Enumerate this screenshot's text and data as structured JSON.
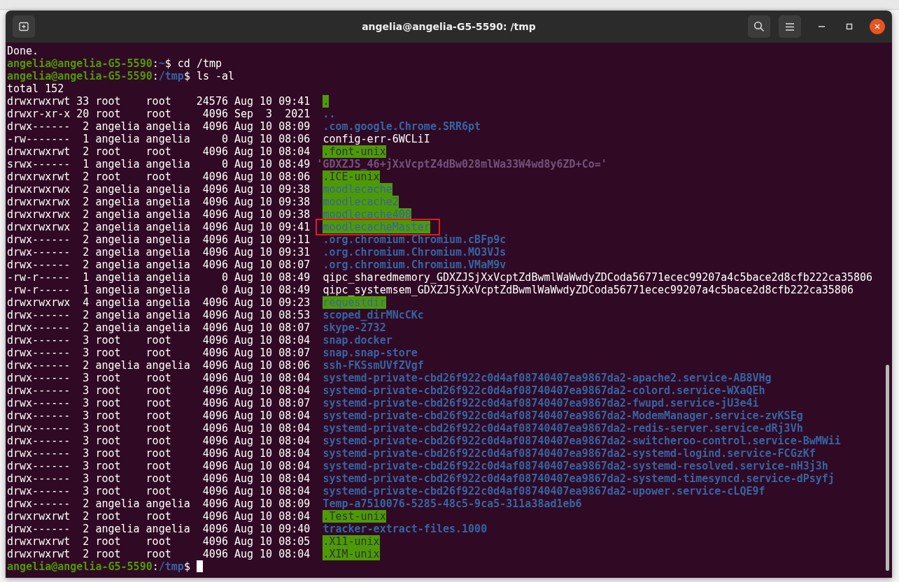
{
  "window": {
    "title": "angelia@angelia-G5-5590: /tmp"
  },
  "terminal": {
    "lines": [
      {
        "kind": "text",
        "text": "Done."
      },
      {
        "kind": "prompt",
        "user_host": "angelia@angelia-G5-5590",
        "colon": ":",
        "path": "~",
        "symbol": "$",
        "command": "cd /tmp"
      },
      {
        "kind": "prompt",
        "user_host": "angelia@angelia-G5-5590",
        "colon": ":",
        "path": "/tmp",
        "symbol": "$",
        "command": "ls -al"
      },
      {
        "kind": "text",
        "text": "total 152"
      },
      {
        "kind": "entry",
        "perms": "drwxrwxrwt",
        "links": "33",
        "owner": "root",
        "group": "root",
        "size": "24576",
        "date": "Aug 10 09:41",
        "name": ".",
        "bold": false,
        "world_writable": true,
        "sticky": true,
        "highlighted": false
      },
      {
        "kind": "entry",
        "perms": "drwxr-xr-x",
        "links": "20",
        "owner": "root",
        "group": "root",
        "size": "4096",
        "date": "Sep  3  2021",
        "name": "..",
        "color": "#3465a4",
        "bold": true,
        "world_writable": false,
        "highlighted": false
      },
      {
        "kind": "entry",
        "perms": "drwx------",
        "links": "2",
        "owner": "angelia",
        "group": "angelia",
        "size": "4096",
        "date": "Aug 10 08:09",
        "name": ".com.google.Chrome.SRR6pt",
        "color": "#3465a4",
        "bold": true,
        "world_writable": false,
        "highlighted": false
      },
      {
        "kind": "entry",
        "perms": "-rw-------",
        "links": "1",
        "owner": "angelia",
        "group": "angelia",
        "size": "0",
        "date": "Aug 10 08:06",
        "name": "config-err-6WCLiI",
        "color": "#ffffff",
        "bold": false,
        "world_writable": false,
        "highlighted": false
      },
      {
        "kind": "entry",
        "perms": "drwxrwxrwt",
        "links": "2",
        "owner": "root",
        "group": "root",
        "size": "4096",
        "date": "Aug 10 08:04",
        "name": ".font-unix",
        "bold": false,
        "world_writable": true,
        "sticky": true,
        "highlighted": false
      },
      {
        "kind": "entry",
        "perms": "srwx------",
        "links": "1",
        "owner": "angelia",
        "group": "angelia",
        "size": "0",
        "date": "Aug 10 08:49",
        "name": "'GDXZJS_46+jXxVcptZ4dBw028mlWa33W4wd8y6ZD+Co='",
        "color": "#75507b",
        "bold": true,
        "world_writable": false,
        "quoted": true,
        "highlighted": false
      },
      {
        "kind": "entry",
        "perms": "drwxrwxrwt",
        "links": "2",
        "owner": "root",
        "group": "root",
        "size": "4096",
        "date": "Aug 10 08:06",
        "name": ".ICE-unix",
        "bold": false,
        "world_writable": true,
        "sticky": true,
        "highlighted": false
      },
      {
        "kind": "entry",
        "perms": "drwxrwxrwx",
        "links": "2",
        "owner": "angelia",
        "group": "angelia",
        "size": "4096",
        "date": "Aug 10 09:38",
        "name": "moodlecache",
        "bold": false,
        "world_writable": true,
        "sticky": false,
        "highlighted": false
      },
      {
        "kind": "entry",
        "perms": "drwxrwxrwx",
        "links": "2",
        "owner": "angelia",
        "group": "angelia",
        "size": "4096",
        "date": "Aug 10 09:38",
        "name": "moodlecache2",
        "bold": false,
        "world_writable": true,
        "sticky": false,
        "highlighted": false
      },
      {
        "kind": "entry",
        "perms": "drwxrwxrwx",
        "links": "2",
        "owner": "angelia",
        "group": "angelia",
        "size": "4096",
        "date": "Aug 10 09:38",
        "name": "moodlecache400",
        "bold": false,
        "world_writable": true,
        "sticky": false,
        "highlighted": false
      },
      {
        "kind": "entry",
        "perms": "drwxrwxrwx",
        "links": "2",
        "owner": "angelia",
        "group": "angelia",
        "size": "4096",
        "date": "Aug 10 09:41",
        "name": "moodlecacheMaster",
        "bold": false,
        "world_writable": true,
        "sticky": false,
        "highlighted": true
      },
      {
        "kind": "entry",
        "perms": "drwx------",
        "links": "2",
        "owner": "angelia",
        "group": "angelia",
        "size": "4096",
        "date": "Aug 10 09:11",
        "name": ".org.chromium.Chromium.cBFp9c",
        "color": "#3465a4",
        "bold": true,
        "world_writable": false,
        "highlighted": false
      },
      {
        "kind": "entry",
        "perms": "drwx------",
        "links": "2",
        "owner": "angelia",
        "group": "angelia",
        "size": "4096",
        "date": "Aug 10 09:31",
        "name": ".org.chromium.Chromium.MO3VJs",
        "color": "#3465a4",
        "bold": true,
        "world_writable": false,
        "highlighted": false
      },
      {
        "kind": "entry",
        "perms": "drwx------",
        "links": "2",
        "owner": "angelia",
        "group": "angelia",
        "size": "4096",
        "date": "Aug 10 08:07",
        "name": ".org.chromium.Chromium.VMaM9v",
        "color": "#3465a4",
        "bold": true,
        "world_writable": false,
        "highlighted": false
      },
      {
        "kind": "entry",
        "perms": "-rw-r-----",
        "links": "1",
        "owner": "angelia",
        "group": "angelia",
        "size": "0",
        "date": "Aug 10 08:49",
        "name": "qipc_sharedmemory_GDXZJSjXxVcptZdBwmlWaWwdyZDCoda56771ecec99207a4c5bace2d8cfb222ca35806",
        "color": "#ffffff",
        "bold": false,
        "world_writable": false,
        "highlighted": false
      },
      {
        "kind": "entry",
        "perms": "-rw-r-----",
        "links": "1",
        "owner": "angelia",
        "group": "angelia",
        "size": "0",
        "date": "Aug 10 08:49",
        "name": "qipc_systemsem_GDXZJSjXxVcptZdBwmlWaWwdyZDCoda56771ecec99207a4c5bace2d8cfb222ca35806",
        "color": "#ffffff",
        "bold": false,
        "world_writable": false,
        "highlighted": false
      },
      {
        "kind": "entry",
        "perms": "drwxrwxrwx",
        "links": "4",
        "owner": "angelia",
        "group": "angelia",
        "size": "4096",
        "date": "Aug 10 09:23",
        "name": "requestdir",
        "bold": false,
        "world_writable": true,
        "sticky": false,
        "highlighted": false
      },
      {
        "kind": "entry",
        "perms": "drwx------",
        "links": "2",
        "owner": "angelia",
        "group": "angelia",
        "size": "4096",
        "date": "Aug 10 08:53",
        "name": "scoped_dirMNcCKc",
        "color": "#3465a4",
        "bold": true,
        "world_writable": false,
        "highlighted": false
      },
      {
        "kind": "entry",
        "perms": "drwx------",
        "links": "2",
        "owner": "angelia",
        "group": "angelia",
        "size": "4096",
        "date": "Aug 10 08:07",
        "name": "skype-2732",
        "color": "#3465a4",
        "bold": true,
        "world_writable": false,
        "highlighted": false
      },
      {
        "kind": "entry",
        "perms": "drwx------",
        "links": "3",
        "owner": "root",
        "group": "root",
        "size": "4096",
        "date": "Aug 10 08:04",
        "name": "snap.docker",
        "color": "#3465a4",
        "bold": true,
        "world_writable": false,
        "highlighted": false
      },
      {
        "kind": "entry",
        "perms": "drwx------",
        "links": "3",
        "owner": "root",
        "group": "root",
        "size": "4096",
        "date": "Aug 10 08:07",
        "name": "snap.snap-store",
        "color": "#3465a4",
        "bold": true,
        "world_writable": false,
        "highlighted": false
      },
      {
        "kind": "entry",
        "perms": "drwx------",
        "links": "2",
        "owner": "angelia",
        "group": "angelia",
        "size": "4096",
        "date": "Aug 10 08:06",
        "name": "ssh-FKSsmUVfZVgf",
        "color": "#3465a4",
        "bold": true,
        "world_writable": false,
        "highlighted": false
      },
      {
        "kind": "entry",
        "perms": "drwx------",
        "links": "3",
        "owner": "root",
        "group": "root",
        "size": "4096",
        "date": "Aug 10 08:04",
        "name": "systemd-private-cbd26f922c0d4af08740407ea9867da2-apache2.service-AB8VHg",
        "color": "#3465a4",
        "bold": true,
        "world_writable": false,
        "highlighted": false
      },
      {
        "kind": "entry",
        "perms": "drwx------",
        "links": "3",
        "owner": "root",
        "group": "root",
        "size": "4096",
        "date": "Aug 10 08:04",
        "name": "systemd-private-cbd26f922c0d4af08740407ea9867da2-colord.service-WXaQEh",
        "color": "#3465a4",
        "bold": true,
        "world_writable": false,
        "highlighted": false
      },
      {
        "kind": "entry",
        "perms": "drwx------",
        "links": "3",
        "owner": "root",
        "group": "root",
        "size": "4096",
        "date": "Aug 10 08:07",
        "name": "systemd-private-cbd26f922c0d4af08740407ea9867da2-fwupd.service-jU3e4i",
        "color": "#3465a4",
        "bold": true,
        "world_writable": false,
        "highlighted": false
      },
      {
        "kind": "entry",
        "perms": "drwx------",
        "links": "3",
        "owner": "root",
        "group": "root",
        "size": "4096",
        "date": "Aug 10 08:04",
        "name": "systemd-private-cbd26f922c0d4af08740407ea9867da2-ModemManager.service-zvKSEg",
        "color": "#3465a4",
        "bold": true,
        "world_writable": false,
        "highlighted": false
      },
      {
        "kind": "entry",
        "perms": "drwx------",
        "links": "3",
        "owner": "root",
        "group": "root",
        "size": "4096",
        "date": "Aug 10 08:04",
        "name": "systemd-private-cbd26f922c0d4af08740407ea9867da2-redis-server.service-dRj3Vh",
        "color": "#3465a4",
        "bold": true,
        "world_writable": false,
        "highlighted": false
      },
      {
        "kind": "entry",
        "perms": "drwx------",
        "links": "3",
        "owner": "root",
        "group": "root",
        "size": "4096",
        "date": "Aug 10 08:04",
        "name": "systemd-private-cbd26f922c0d4af08740407ea9867da2-switcheroo-control.service-BwMWii",
        "color": "#3465a4",
        "bold": true,
        "world_writable": false,
        "highlighted": false
      },
      {
        "kind": "entry",
        "perms": "drwx------",
        "links": "3",
        "owner": "root",
        "group": "root",
        "size": "4096",
        "date": "Aug 10 08:04",
        "name": "systemd-private-cbd26f922c0d4af08740407ea9867da2-systemd-logind.service-FCGzKf",
        "color": "#3465a4",
        "bold": true,
        "world_writable": false,
        "highlighted": false
      },
      {
        "kind": "entry",
        "perms": "drwx------",
        "links": "3",
        "owner": "root",
        "group": "root",
        "size": "4096",
        "date": "Aug 10 08:04",
        "name": "systemd-private-cbd26f922c0d4af08740407ea9867da2-systemd-resolved.service-nH3j3h",
        "color": "#3465a4",
        "bold": true,
        "world_writable": false,
        "highlighted": false
      },
      {
        "kind": "entry",
        "perms": "drwx------",
        "links": "3",
        "owner": "root",
        "group": "root",
        "size": "4096",
        "date": "Aug 10 08:04",
        "name": "systemd-private-cbd26f922c0d4af08740407ea9867da2-systemd-timesyncd.service-dPsyfj",
        "color": "#3465a4",
        "bold": true,
        "world_writable": false,
        "highlighted": false
      },
      {
        "kind": "entry",
        "perms": "drwx------",
        "links": "3",
        "owner": "root",
        "group": "root",
        "size": "4096",
        "date": "Aug 10 08:04",
        "name": "systemd-private-cbd26f922c0d4af08740407ea9867da2-upower.service-cLQE9f",
        "color": "#3465a4",
        "bold": true,
        "world_writable": false,
        "highlighted": false
      },
      {
        "kind": "entry",
        "perms": "drwx------",
        "links": "2",
        "owner": "angelia",
        "group": "angelia",
        "size": "4096",
        "date": "Aug 10 08:09",
        "name": "Temp-a7510076-5285-48c5-9ca5-311a38ad1eb6",
        "color": "#3465a4",
        "bold": true,
        "world_writable": false,
        "highlighted": false
      },
      {
        "kind": "entry",
        "perms": "drwxrwxrwt",
        "links": "2",
        "owner": "root",
        "group": "root",
        "size": "4096",
        "date": "Aug 10 08:04",
        "name": ".Test-unix",
        "bold": false,
        "world_writable": true,
        "sticky": true,
        "highlighted": false
      },
      {
        "kind": "entry",
        "perms": "drwx------",
        "links": "2",
        "owner": "angelia",
        "group": "angelia",
        "size": "4096",
        "date": "Aug 10 09:40",
        "name": "tracker-extract-files.1000",
        "color": "#3465a4",
        "bold": true,
        "world_writable": false,
        "highlighted": false
      },
      {
        "kind": "entry",
        "perms": "drwxrwxrwt",
        "links": "2",
        "owner": "root",
        "group": "root",
        "size": "4096",
        "date": "Aug 10 08:05",
        "name": ".X11-unix",
        "bold": false,
        "world_writable": true,
        "sticky": true,
        "highlighted": false
      },
      {
        "kind": "entry",
        "perms": "drwxrwxrwt",
        "links": "2",
        "owner": "root",
        "group": "root",
        "size": "4096",
        "date": "Aug 10 08:04",
        "name": ".XIM-unix",
        "bold": false,
        "world_writable": true,
        "sticky": true,
        "highlighted": false
      },
      {
        "kind": "prompt",
        "user_host": "angelia@angelia-G5-5590",
        "colon": ":",
        "path": "/tmp",
        "symbol": "$",
        "cursor": true
      }
    ]
  }
}
